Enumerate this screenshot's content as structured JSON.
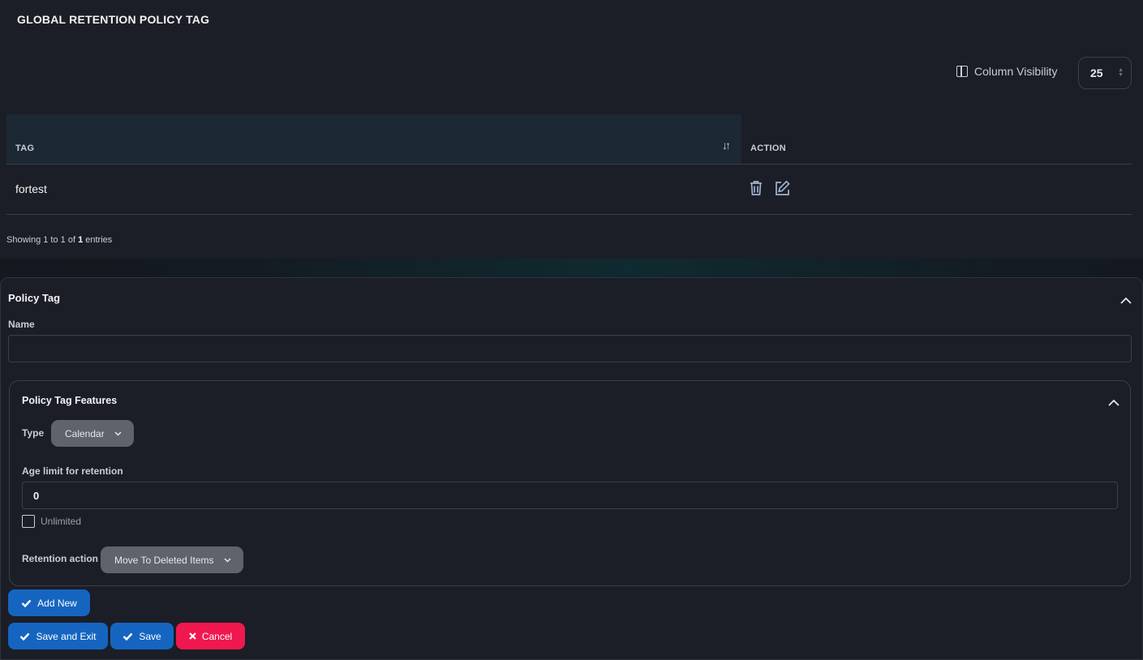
{
  "page": {
    "title": "GLOBAL RETENTION POLICY TAG"
  },
  "toolbar": {
    "column_visibility_label": "Column Visibility",
    "page_size": "25"
  },
  "table": {
    "columns": [
      "TAG",
      "ACTION"
    ],
    "rows": [
      {
        "tag": "fortest"
      }
    ],
    "info": {
      "prefix": "Showing 1 to 1 of",
      "total": "1",
      "suffix": "entries"
    }
  },
  "form": {
    "section_title": "Policy Tag",
    "name_label": "Name",
    "name_value": "",
    "features": {
      "title": "Policy Tag Features",
      "type_label": "Type",
      "type_value": "Calendar",
      "age_limit_label": "Age limit for retention",
      "age_limit_value": "0",
      "unlimited_label": "Unlimited",
      "unlimited_checked": false,
      "retention_action_label": "Retention action",
      "retention_action_value": "Move To Deleted Items"
    }
  },
  "buttons": {
    "add_new": "Add New",
    "save_and_exit": "Save and Exit",
    "save": "Save",
    "cancel": "Cancel"
  },
  "colors": {
    "primary": "#1565c0",
    "danger": "#f0184f",
    "panel": "#1b1e26"
  },
  "icons": {
    "column_visibility": "columns-icon",
    "sort": "sort-icon",
    "delete": "trash-icon",
    "edit": "edit-icon",
    "collapse": "chevron-up-icon",
    "dropdown": "chevron-down-icon",
    "confirm": "check-icon",
    "cancel": "x-icon"
  }
}
